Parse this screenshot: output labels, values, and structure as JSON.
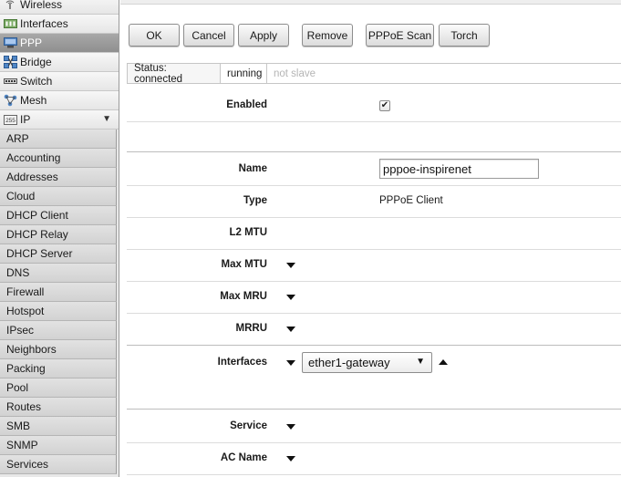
{
  "sidebar": {
    "items": [
      {
        "label": "Wireless",
        "icon": "wireless-icon"
      },
      {
        "label": "Interfaces",
        "icon": "interfaces-icon"
      },
      {
        "label": "PPP",
        "icon": "ppp-icon"
      },
      {
        "label": "Bridge",
        "icon": "bridge-icon"
      },
      {
        "label": "Switch",
        "icon": "switch-icon"
      },
      {
        "label": "Mesh",
        "icon": "mesh-icon"
      },
      {
        "label": "IP",
        "icon": "ip-icon",
        "arrow": "▼"
      }
    ],
    "active": "PPP",
    "ip_submenu": [
      "ARP",
      "Accounting",
      "Addresses",
      "Cloud",
      "DHCP Client",
      "DHCP Relay",
      "DHCP Server",
      "DNS",
      "Firewall",
      "Hotspot",
      "IPsec",
      "Neighbors",
      "Packing",
      "Pool",
      "Routes",
      "SMB",
      "SNMP",
      "Services"
    ]
  },
  "toolbar": {
    "ok": "OK",
    "cancel": "Cancel",
    "apply": "Apply",
    "remove": "Remove",
    "pppoe_scan": "PPPoE Scan",
    "torch": "Torch"
  },
  "status": {
    "status": "Status: connected",
    "running": "running",
    "slave": "not slave"
  },
  "form": {
    "enabled_label": "Enabled",
    "enabled_checked": true,
    "name_label": "Name",
    "name_value": "pppoe-inspirenet",
    "type_label": "Type",
    "type_value": "PPPoE Client",
    "l2mtu_label": "L2 MTU",
    "maxmtu_label": "Max MTU",
    "maxmru_label": "Max MRU",
    "mrru_label": "MRRU",
    "interfaces_label": "Interfaces",
    "interfaces_value": "ether1-gateway",
    "service_label": "Service",
    "acname_label": "AC Name"
  },
  "colors": {
    "sidebar_bg": "#e8e8e8",
    "active_item": "#9b9b9b",
    "submenu_bg": "#d8d8d8"
  }
}
